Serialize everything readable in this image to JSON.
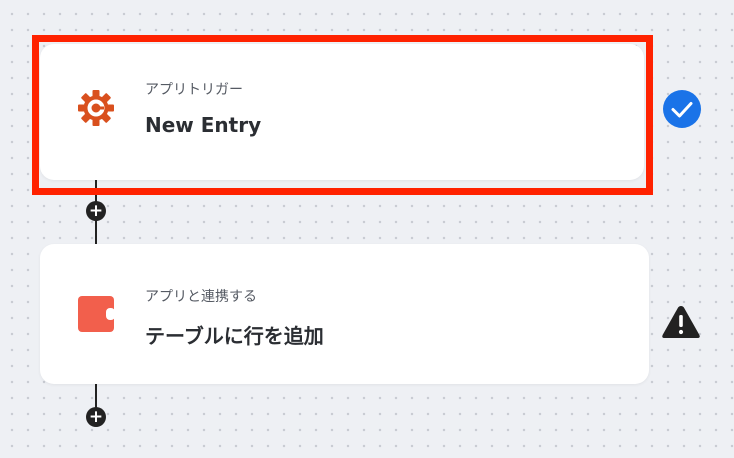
{
  "steps": [
    {
      "category": "アプリトリガー",
      "title": "New Entry",
      "app_icon": "cognito-gear-icon",
      "status": "check-circle-icon"
    },
    {
      "category": "アプリと連携する",
      "title": "テーブルに行を追加",
      "app_icon": "coda-icon",
      "status": "warning-triangle-icon"
    }
  ],
  "add_node_symbol": "+",
  "colors": {
    "trigger_icon": "#d9501e",
    "coda_icon": "#f25f4c",
    "check": "#1a73e8",
    "warning": "#222222",
    "highlight": "#ff2200",
    "connector": "#222222"
  }
}
